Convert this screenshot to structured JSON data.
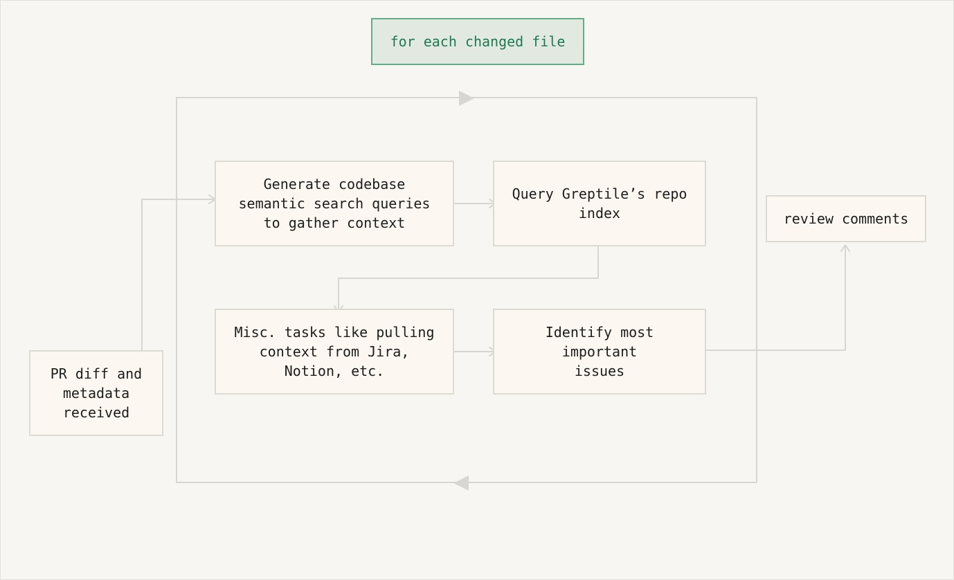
{
  "diagram": {
    "loop_label": "for each changed file",
    "nodes": {
      "pr_input": "PR diff and\nmetadata\nreceived",
      "generate_queries": "Generate codebase\nsemantic search queries\nto gather context",
      "query_index": "Query Greptile’s repo\nindex",
      "misc_tasks": "Misc. tasks like pulling\ncontext from Jira,\nNotion, etc.",
      "identify_issues": "Identify most\nimportant\nissues",
      "review_comments": "review comments"
    },
    "colors": {
      "background": "#f8f6f2",
      "node_fill": "#fcf8f1",
      "node_border": "#dddad4",
      "connector": "#d8d6d2",
      "loop_label_fill": "#e1e9e1",
      "loop_label_border": "#5fae85",
      "loop_label_text": "#1f7a52"
    }
  }
}
